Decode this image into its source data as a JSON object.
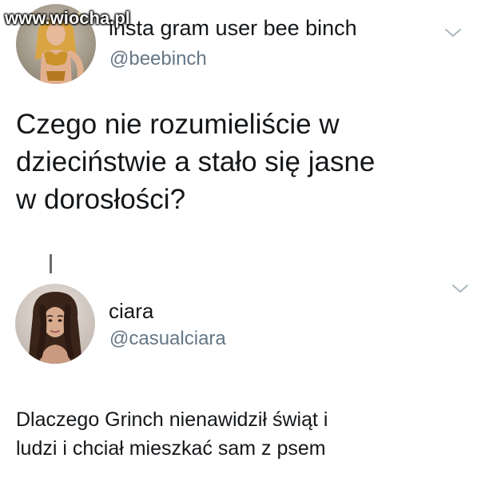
{
  "watermark": "www.wiocha.pl",
  "tweets": [
    {
      "display_name": "insta gram user bee binch",
      "handle": "@beebinch",
      "text": "Czego nie rozumieliście w\ndzieciństwie a stało się jasne\nw dorosłości?",
      "avatar_icon": "avatar-photo-costume",
      "menu_icon": "chevron-down-icon"
    },
    {
      "display_name": "ciara",
      "handle": "@casualciara",
      "text": "Dlaczego Grinch nienawidził świąt i\nludzi i chciał mieszkać sam z psem",
      "avatar_icon": "avatar-photo-portrait",
      "menu_icon": "chevron-down-icon"
    }
  ],
  "colors": {
    "text_primary": "#14171a",
    "text_secondary": "#657786",
    "chevron": "#aab8c2",
    "thread_line": "#6b6b6b"
  }
}
